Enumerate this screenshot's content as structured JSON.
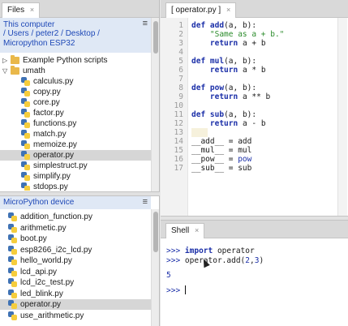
{
  "left_panel": {
    "tab_label": "Files",
    "tab_close": "×",
    "files_header": {
      "title": "This computer",
      "path": "/ Users / peter2 / Desktop /",
      "device": "Micropython ESP32",
      "menu_glyph": "≡"
    },
    "tree": [
      {
        "label": "Example Python scripts",
        "kind": "folder",
        "expand": "▷",
        "depth": 0
      },
      {
        "label": "umath",
        "kind": "folder",
        "expand": "▽",
        "depth": 0
      },
      {
        "label": "calculus.py",
        "kind": "file",
        "depth": 1
      },
      {
        "label": "copy.py",
        "kind": "file",
        "depth": 1
      },
      {
        "label": "core.py",
        "kind": "file",
        "depth": 1
      },
      {
        "label": "factor.py",
        "kind": "file",
        "depth": 1
      },
      {
        "label": "functions.py",
        "kind": "file",
        "depth": 1
      },
      {
        "label": "match.py",
        "kind": "file",
        "depth": 1
      },
      {
        "label": "memoize.py",
        "kind": "file",
        "depth": 1
      },
      {
        "label": "operator.py",
        "kind": "file",
        "depth": 1,
        "selected": true
      },
      {
        "label": "simplestruct.py",
        "kind": "file",
        "depth": 1
      },
      {
        "label": "simplify.py",
        "kind": "file",
        "depth": 1
      },
      {
        "label": "stdops.py",
        "kind": "file",
        "depth": 1
      }
    ],
    "device_header": {
      "title": "MicroPython device",
      "menu_glyph": "≡"
    },
    "device_files": [
      {
        "label": "addition_function.py"
      },
      {
        "label": "arithmetic.py"
      },
      {
        "label": "boot.py"
      },
      {
        "label": "esp8266_i2c_lcd.py"
      },
      {
        "label": "hello_world.py"
      },
      {
        "label": "lcd_api.py"
      },
      {
        "label": "lcd_i2c_test.py"
      },
      {
        "label": "led_blink.py"
      },
      {
        "label": "operator.py",
        "selected": true
      },
      {
        "label": "use_arithmetic.py"
      }
    ]
  },
  "editor": {
    "tab_label": "[ operator.py ]",
    "tab_close": "×",
    "line_numbers": [
      "1",
      "2",
      "3",
      "4",
      "5",
      "6",
      "7",
      "8",
      "9",
      "10",
      "11",
      "12",
      "13",
      "14",
      "15",
      "16",
      "17"
    ]
  },
  "shell": {
    "tab_label": "Shell",
    "tab_close": "×",
    "prompt": ">>>",
    "line1_kw": "import",
    "line1_rest": " operator",
    "line2_a": "operator",
    "line2_b": ".add(",
    "line2_c": "2",
    "line2_d": ",",
    "line2_e": "3",
    "line2_f": ")",
    "output": "5"
  },
  "colors": {
    "keyword": "#1b2fa8",
    "string": "#2c8c2c",
    "header_text": "#1f49b7",
    "header_bg": "#dfe8f5",
    "selection": "#d6d6d6"
  }
}
